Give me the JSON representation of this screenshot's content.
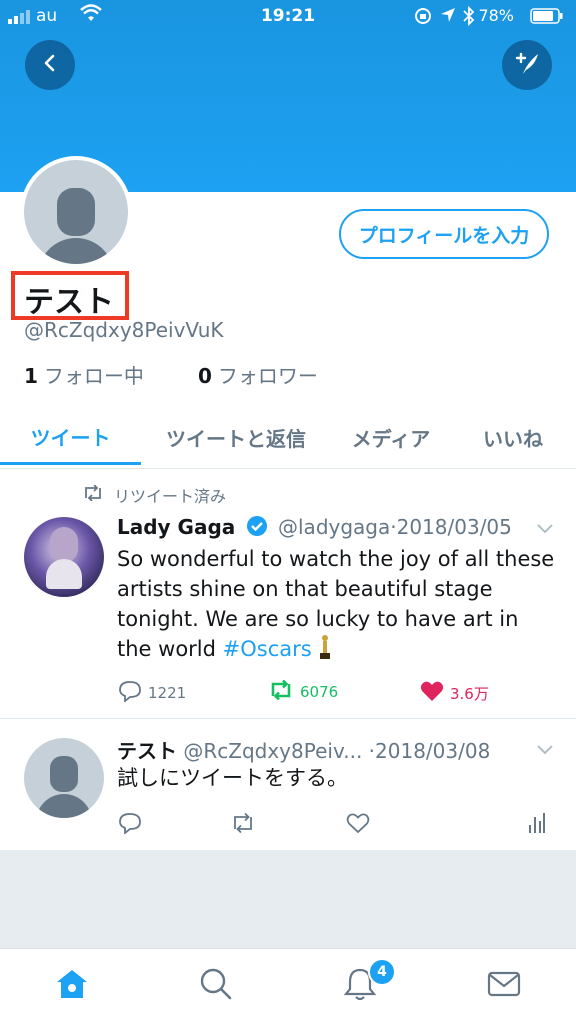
{
  "status_bar": {
    "carrier": "au",
    "time": "19:21",
    "battery": "78%"
  },
  "profile": {
    "name": "テスト",
    "handle": "@RcZqdxy8PeivVuK",
    "edit_button": "プロフィールを入力",
    "following_count": "1",
    "following_label": "フォロー中",
    "followers_count": "0",
    "followers_label": "フォロワー"
  },
  "tabs": [
    "ツイート",
    "ツイートと返信",
    "メディア",
    "いいね"
  ],
  "tweets": [
    {
      "retweet_label": "リツイート済み",
      "name": "Lady Gaga",
      "handle": "@ladygaga",
      "date": "·2018/03/05",
      "text": "So wonderful to watch the joy of all these artists shine on that beautiful stage tonight. We are so lucky to have art in the world ",
      "hashtag": "#Oscars",
      "replies": "1221",
      "retweets": "6076",
      "likes": "3.6万"
    },
    {
      "name": "テスト",
      "handle": "@RcZqdxy8Peiv...",
      "date": "·2018/03/08",
      "text": "試しにツイートをする。"
    }
  ],
  "notifications_badge": "4",
  "colors": {
    "brand": "#1da1f2",
    "retweet_green": "#17bf63",
    "like_red": "#e0245e",
    "highlight_box": "#ee3a24"
  }
}
